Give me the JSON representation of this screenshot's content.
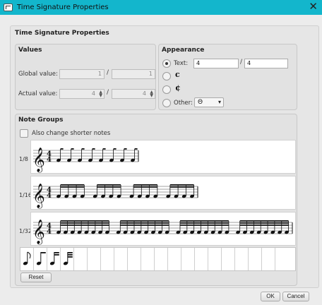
{
  "window": {
    "title": "Time Signature Properties",
    "close_glyph": "✕"
  },
  "dialog": {
    "title": "Time Signature Properties"
  },
  "values": {
    "title": "Values",
    "global_label": "Global value:",
    "global_num": "1",
    "global_den": "1",
    "actual_label": "Actual value:",
    "actual_num": "4",
    "actual_den": "4",
    "slash": "/"
  },
  "appearance": {
    "title": "Appearance",
    "text_label": "Text:",
    "text_num": "4",
    "text_den": "4",
    "common_glyph": "c",
    "cut_glyph": "¢",
    "other_label": "Other:",
    "other_value": "Θ",
    "selected": "text",
    "combo_arrow": "▾"
  },
  "note_groups": {
    "title": "Note Groups",
    "also_change_label": "Also change shorter notes",
    "also_change_checked": false,
    "groups": [
      {
        "label": "1/8",
        "notes": 8,
        "beam_size": 1,
        "beams": 1
      },
      {
        "label": "1/16",
        "notes": 16,
        "beam_size": 4,
        "beams": 2
      },
      {
        "label": "1/32",
        "notes": 32,
        "beam_size": 8,
        "beams": 3
      }
    ],
    "palette_icons": [
      "eighth-note-icon",
      "sixteenth-note-icon",
      "thirty-second-note-icon",
      "sixty-fourth-note-icon"
    ],
    "palette_cells": 20,
    "time_sig_num": "4",
    "time_sig_den": "4",
    "reset_label": "Reset"
  },
  "buttons": {
    "ok": "OK",
    "cancel": "Cancel"
  }
}
